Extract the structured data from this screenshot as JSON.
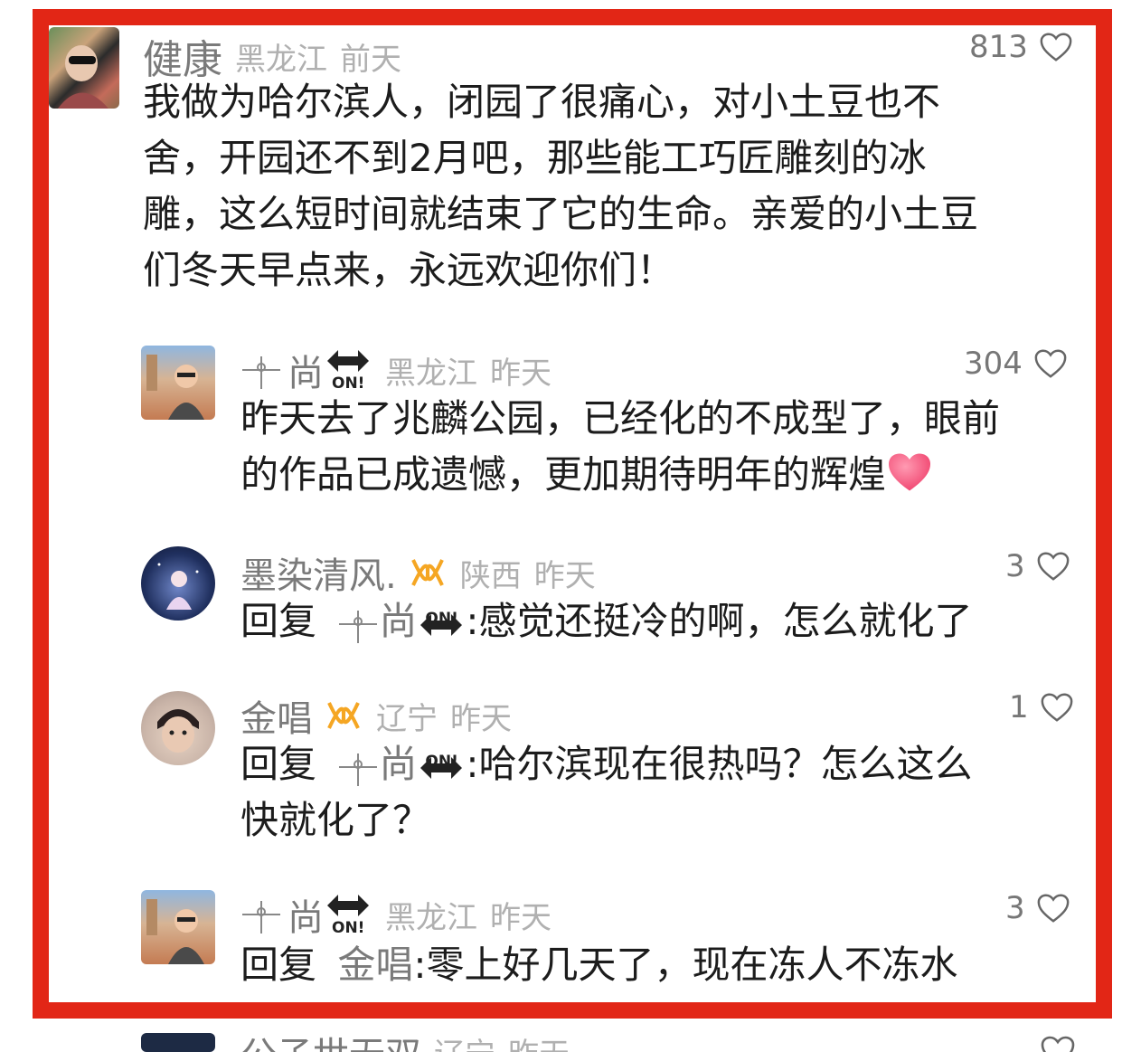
{
  "colors": {
    "frame": "#e22616",
    "name": "#7a7a7a",
    "meta": "#b0b0b0",
    "text": "#1c1c1c"
  },
  "comments": [
    {
      "name": "健康",
      "location": "黑龙江",
      "time": "前天",
      "likes": "813",
      "text_lines": [
        "我做为哈尔滨人，闭园了很痛心，对小土豆也不",
        "舍，开园还不到2月吧，那些能工巧匠雕刻的冰",
        "雕，这么短时间就结束了它的生命。亲爱的小土豆",
        "们冬天早点来，永远欢迎你们！"
      ]
    },
    {
      "name": "尚",
      "location": "黑龙江",
      "time": "昨天",
      "likes": "304",
      "badge": "ON!",
      "text_lines": [
        "昨天去了兆麟公园，已经化的不成型了，眼前",
        "的作品已成遗憾，更加期待明年的辉煌"
      ],
      "emoji": "heart-emoji"
    },
    {
      "name": "墨染清风.",
      "location": "陕西",
      "time": "昨天",
      "likes": "3",
      "reply_prefix": "回复",
      "mention": "尚",
      "badge": "ON!",
      "text_lines": [
        ":感觉还挺冷的啊，怎么就化了"
      ]
    },
    {
      "name": "金唱",
      "location": "辽宁",
      "time": "昨天",
      "likes": "1",
      "reply_prefix": "回复",
      "mention": "尚",
      "badge": "ON!",
      "text_lines": [
        ":哈尔滨现在很热吗？怎么这么",
        "快就化了？"
      ]
    },
    {
      "name": "尚",
      "location": "黑龙江",
      "time": "昨天",
      "likes": "3",
      "badge": "ON!",
      "reply_prefix": "回复",
      "mention": "金唱",
      "text_lines": [
        ":零上好几天了，现在冻人不冻水"
      ]
    },
    {
      "name": "公子世无双",
      "location": "辽宁",
      "time": "昨天"
    }
  ]
}
